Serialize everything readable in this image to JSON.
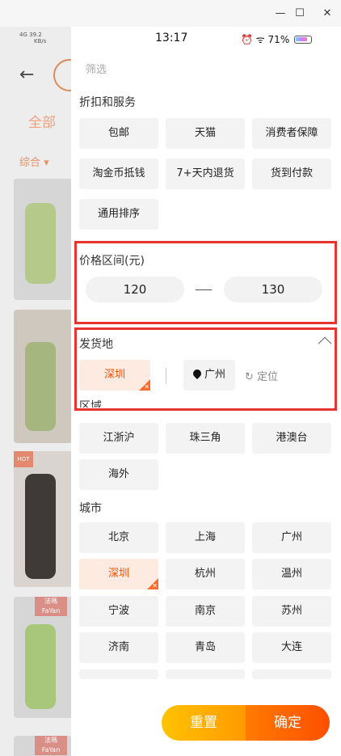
{
  "window": {
    "min_label": "—",
    "max_label": "☐",
    "close_label": "✕"
  },
  "status_bar": {
    "time": "13:17",
    "network": "4G",
    "speed_value": "39.2",
    "speed_unit": "KB/s",
    "battery": "71%",
    "icons": "⏰ ᯤ"
  },
  "background": {
    "back_icon": "←",
    "tab_all": "全部",
    "sort_label": "综合 ▾",
    "hot_badge": "HOT",
    "brand_badge_1": "法瑪 FaYan",
    "brand_badge_2": "法瑪 FaYan"
  },
  "panel": {
    "title": "筛选",
    "discount_section": {
      "title": "折扣和服务",
      "options": [
        "包邮",
        "天猫",
        "消费者保障",
        "淘金币抵钱",
        "7+天内退货",
        "货到付款",
        "通用排序"
      ]
    },
    "price_section": {
      "title": "价格区间(元)",
      "min": "120",
      "max": "130"
    },
    "ship_section": {
      "title": "发货地",
      "selected": "深圳",
      "location": "广州",
      "locate_label": "定位",
      "region_title": "区域",
      "regions": [
        "江浙沪",
        "珠三角",
        "港澳台",
        "海外"
      ],
      "city_title": "城市",
      "cities": [
        "北京",
        "上海",
        "广州",
        "深圳",
        "杭州",
        "温州",
        "宁波",
        "南京",
        "苏州",
        "济南",
        "青岛",
        "大连"
      ],
      "selected_city": "深圳"
    },
    "reset_label": "重置",
    "confirm_label": "确定"
  }
}
